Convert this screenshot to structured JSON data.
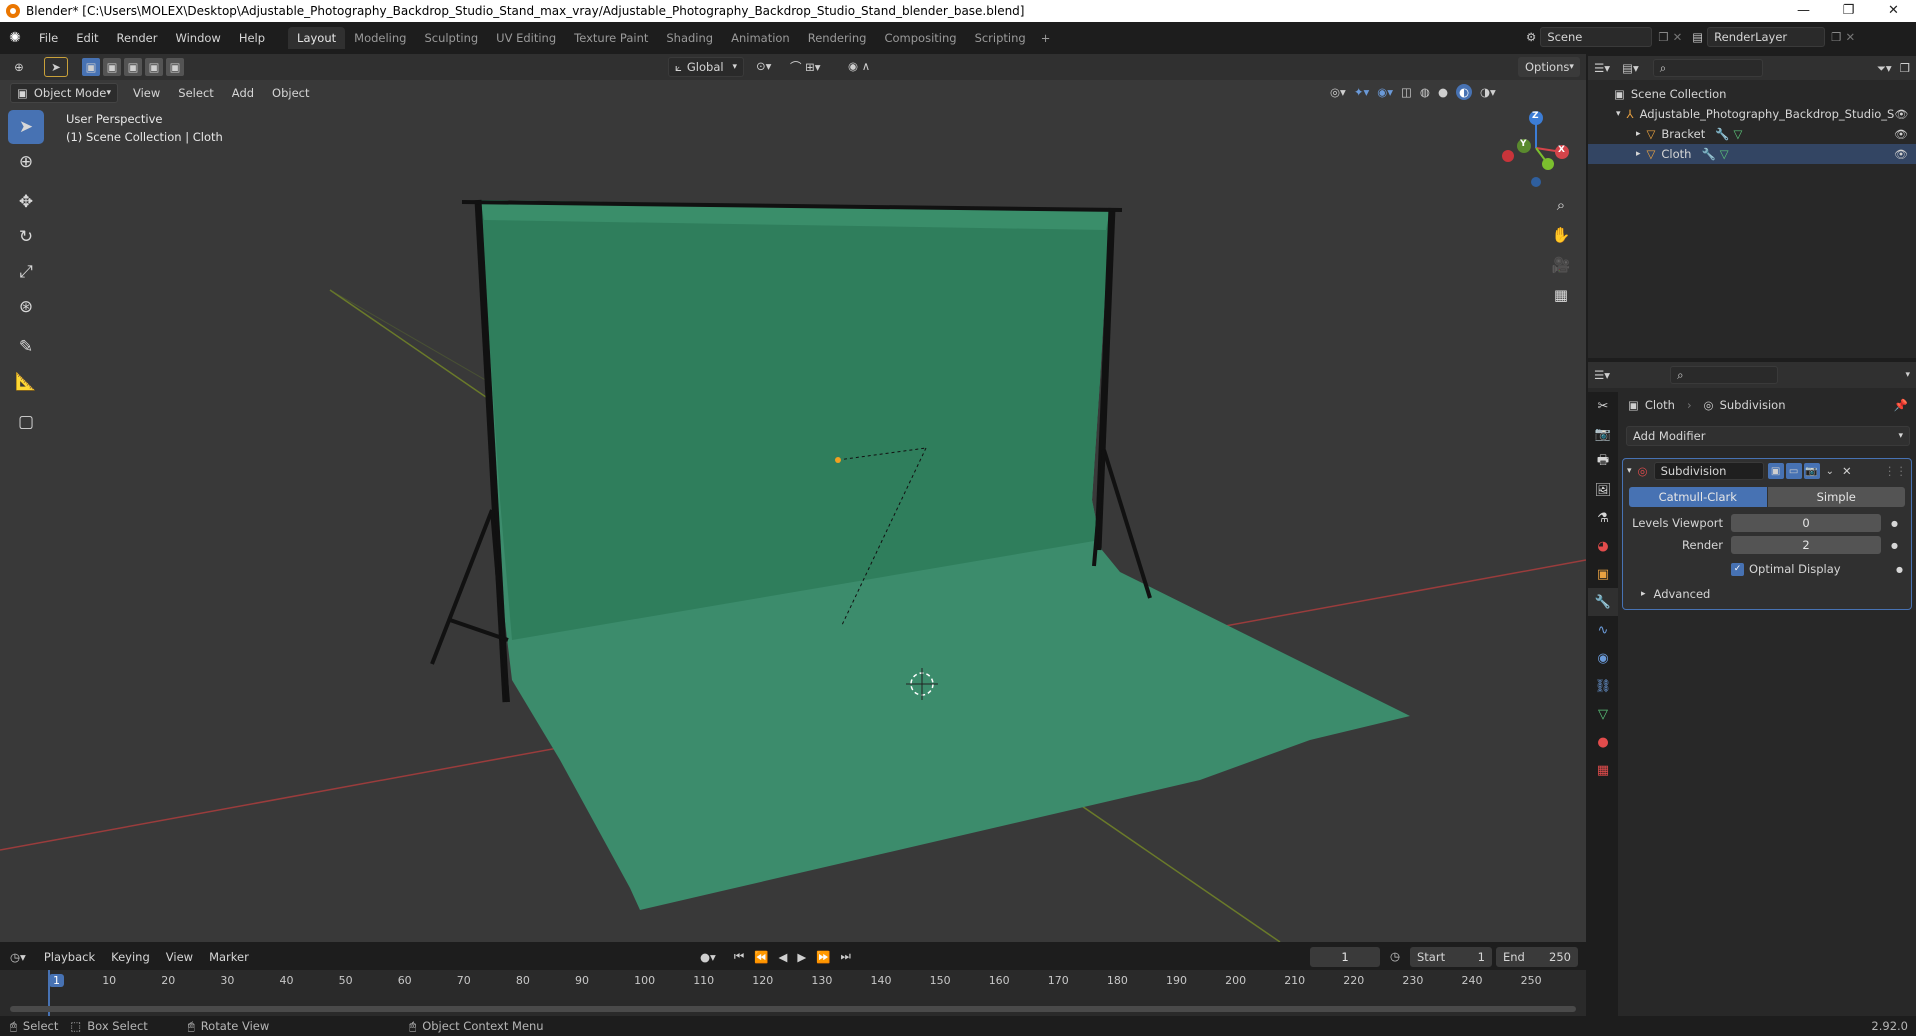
{
  "titlebar": {
    "title": "Blender* [C:\\Users\\MOLEX\\Desktop\\Adjustable_Photography_Backdrop_Studio_Stand_max_vray/Adjustable_Photography_Backdrop_Studio_Stand_blender_base.blend]",
    "minimize": "—",
    "restore": "❐",
    "close": "✕"
  },
  "menu": [
    "File",
    "Edit",
    "Render",
    "Window",
    "Help"
  ],
  "workspaces": [
    {
      "label": "Layout",
      "active": true
    },
    {
      "label": "Modeling"
    },
    {
      "label": "Sculpting"
    },
    {
      "label": "UV Editing"
    },
    {
      "label": "Texture Paint"
    },
    {
      "label": "Shading"
    },
    {
      "label": "Animation"
    },
    {
      "label": "Rendering"
    },
    {
      "label": "Compositing"
    },
    {
      "label": "Scripting"
    }
  ],
  "scene": {
    "label": "Scene",
    "render_layer": "RenderLayer"
  },
  "toolheader": {
    "orientation": "Global",
    "options": "Options"
  },
  "vpheader": {
    "mode": "Object Mode",
    "menus": [
      "View",
      "Select",
      "Add",
      "Object"
    ]
  },
  "viewport": {
    "perspective": "User Perspective",
    "collection_info": "(1) Scene Collection | Cloth",
    "backdrop_color": "#3f9272",
    "bg_color": "#393939"
  },
  "gizmo": {
    "x": "X",
    "y": "Y",
    "z": "Z"
  },
  "outliner": {
    "root": "Scene Collection",
    "items": [
      {
        "label": "Adjustable_Photography_Backdrop_Studio_S",
        "level": 1
      },
      {
        "label": "Bracket",
        "level": 2
      },
      {
        "label": "Cloth",
        "level": 2
      }
    ]
  },
  "properties": {
    "object": "Cloth",
    "modifier_tab": "Subdivision",
    "add_modifier": "Add Modifier",
    "modifier": {
      "name": "Subdivision",
      "type_a": "Catmull-Clark",
      "type_b": "Simple",
      "levels_label": "Levels Viewport",
      "levels_value": "0",
      "render_label": "Render",
      "render_value": "2",
      "optimal": "Optimal Display",
      "advanced": "Advanced"
    }
  },
  "timeline": {
    "menus": [
      "Playback",
      "Keying",
      "View",
      "Marker"
    ],
    "current_frame": "1",
    "start_label": "Start",
    "start": "1",
    "end_label": "End",
    "end": "250",
    "ticks": [
      "1",
      "10",
      "20",
      "30",
      "40",
      "50",
      "60",
      "70",
      "80",
      "90",
      "100",
      "110",
      "120",
      "130",
      "140",
      "150",
      "160",
      "170",
      "180",
      "190",
      "200",
      "210",
      "220",
      "230",
      "240",
      "250"
    ]
  },
  "status": {
    "select": "Select",
    "box_select": "Box Select",
    "rotate": "Rotate View",
    "context": "Object Context Menu",
    "version": "2.92.0"
  }
}
